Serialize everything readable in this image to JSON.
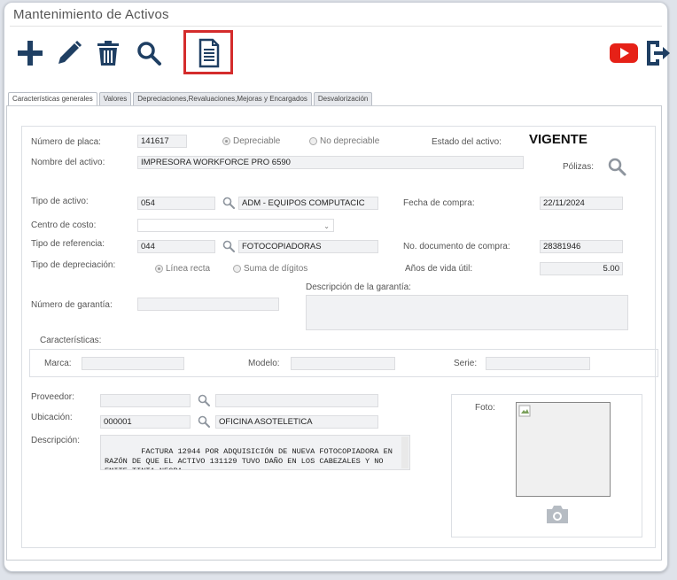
{
  "window": {
    "title": "Mantenimiento de Activos"
  },
  "toolbar": {
    "add": "plus-icon",
    "edit": "pencil-icon",
    "delete": "trash-icon",
    "search": "search-icon",
    "report": "document-icon",
    "youtube": "youtube-icon",
    "exit": "exit-icon"
  },
  "tabs": [
    {
      "label": "Características generales"
    },
    {
      "label": "Valores"
    },
    {
      "label": "Depreciaciones,Revaluaciones,Mejoras y Encargados"
    },
    {
      "label": "Desvalorización"
    }
  ],
  "form": {
    "placa_label": "Número de placa:",
    "placa": "141617",
    "depreciable": "Depreciable",
    "no_depreciable": "No depreciable",
    "estado_label": "Estado del activo:",
    "estado": "VIGENTE",
    "nombre_label": "Nombre del activo:",
    "nombre": "IMPRESORA WORKFORCE PRO 6590",
    "polizas_label": "Pólizas:",
    "tipo_activo_label": "Tipo de activo:",
    "tipo_activo_code": "054",
    "tipo_activo_desc": "ADM - EQUIPOS COMPUTACIC",
    "fecha_compra_label": "Fecha de compra:",
    "fecha_compra": "22/11/2024",
    "centro_costo_label": "Centro de costo:",
    "centro_costo": "",
    "tipo_ref_label": "Tipo de referencia:",
    "tipo_ref_code": "044",
    "tipo_ref_desc": "FOTOCOPIADORAS",
    "no_doc_label": "No. documento de compra:",
    "no_doc": "28381946",
    "tipo_dep_label": "Tipo de depreciación:",
    "linea_recta": "Línea recta",
    "suma_digitos": "Suma de dígitos",
    "anos_label": "Años de vida útil:",
    "anos": "5.00",
    "desc_garantia_label": "Descripción de la garantía:",
    "num_garantia_label": "Número de garantía:",
    "caracteristicas_label": "Características:",
    "marca_label": "Marca:",
    "modelo_label": "Modelo:",
    "serie_label": "Serie:",
    "proveedor_label": "Proveedor:",
    "ubicacion_label": "Ubicación:",
    "ubicacion_code": "000001",
    "ubicacion_desc": "OFICINA ASOTELETICA",
    "descripcion_label": "Descripción:",
    "descripcion": "FACTURA 12944 POR ADQUISICIÓN DE NUEVA FOTOCOPIADORA EN RAZÓN DE QUE EL ACTIVO 131129 TUVO DAÑO EN LOS CABEZALES Y NO EMITE TINTA NEGRA",
    "foto_label": "Foto:"
  },
  "colors": {
    "toolbar_icon": "#1f3f63",
    "highlight": "#d42c2c",
    "youtube": "#e62117"
  }
}
